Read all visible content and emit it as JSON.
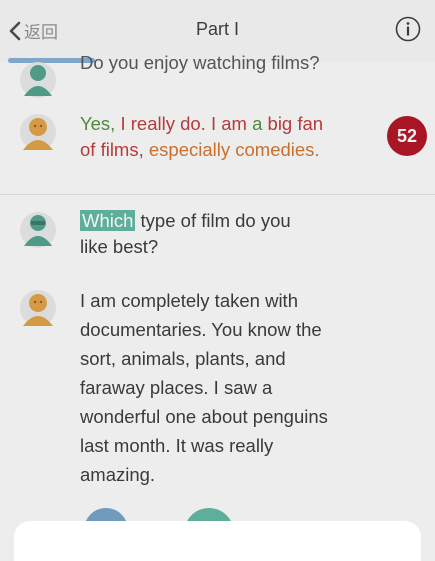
{
  "nav": {
    "back_label": "返回",
    "title": "Part I"
  },
  "progress": {
    "fraction": 0.2
  },
  "messages": {
    "q1_partial": "Do you enjoy watching films?",
    "a1": {
      "w1": "Yes, ",
      "w2": "I really do. ",
      "w3": "I am ",
      "w4": "a ",
      "w5": "big fan",
      "w6": "of films, ",
      "w7": "especially comedies."
    },
    "score": "52",
    "q2": {
      "highlight": "Which",
      "rest1": " type of film do you",
      "rest2": "like best?"
    },
    "a2": [
      "I am completely taken with",
      "documentaries. You know the",
      "sort, animals, plants, and",
      "faraway places. I saw a",
      "wonderful one about penguins",
      "last month. It was really",
      "amazing."
    ]
  },
  "colors": {
    "accent_highlight": "#5fae9b",
    "score_badge": "#a81525",
    "progress": "#7ea7c9"
  }
}
